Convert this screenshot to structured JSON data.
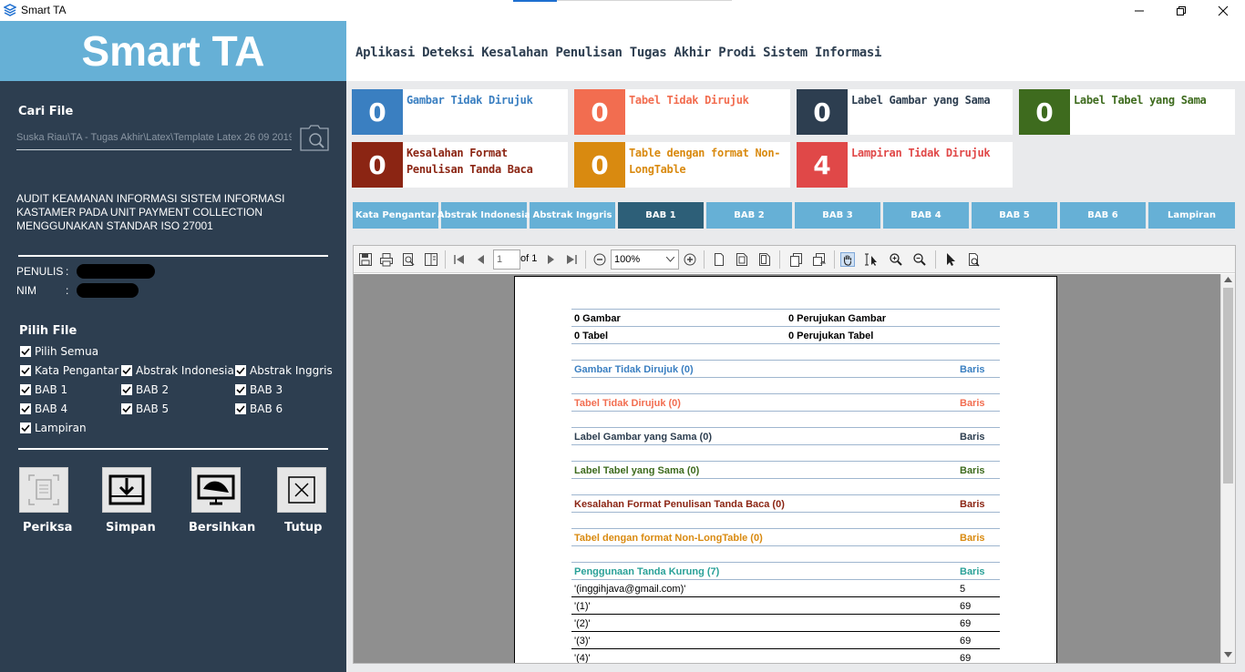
{
  "window": {
    "title": "Smart TA",
    "min_label": "─",
    "max_label": "❐",
    "close_label": "✕"
  },
  "sidebar": {
    "logo": "Smart TA",
    "cari_file": "Cari File",
    "path": "Suska Riau\\TA - Tugas Akhir\\Latex\\Template Latex 26 09 2019",
    "doc_title": "AUDIT KEAMANAN INFORMASI SISTEM INFORMASI KASTAMER PADA UNIT PAYMENT COLLECTION MENGGUNAKAN STANDAR ISO 27001",
    "penulis_label": "PENULIS",
    "nim_label": "NIM",
    "colon": ":",
    "pilih_file": "Pilih File",
    "checkboxes": [
      "Pilih Semua",
      "Kata Pengantar",
      "Abstrak Indonesia",
      "Abstrak Inggris",
      "BAB 1",
      "BAB 2",
      "BAB 3",
      "BAB 4",
      "BAB 5",
      "BAB 6",
      "Lampiran"
    ],
    "actions": [
      "Periksa",
      "Simpan",
      "Bersihkan",
      "Tutup"
    ]
  },
  "header": {
    "title": "Aplikasi Deteksi Kesalahan Penulisan Tugas Akhir Prodi Sistem Informasi"
  },
  "cards": [
    {
      "value": "0",
      "label": "Gambar Tidak Dirujuk",
      "color": "#3a7fc1"
    },
    {
      "value": "0",
      "label": "Tabel Tidak Dirujuk",
      "color": "#f26d50"
    },
    {
      "value": "0",
      "label": "Label Gambar yang Sama",
      "color": "#2d3e50"
    },
    {
      "value": "0",
      "label": "Label Tabel yang Sama",
      "color": "#3e6b1e"
    },
    {
      "value": "0",
      "label": "Kesalahan Format Penulisan Tanda Baca",
      "color": "#8b2513"
    },
    {
      "value": "0",
      "label": "Table dengan format Non-LongTable",
      "color": "#d98a10"
    },
    {
      "value": "4",
      "label": "Lampiran Tidak Dirujuk",
      "color": "#e04848"
    }
  ],
  "tabs": [
    "Kata Pengantar",
    "Abstrak Indonesia",
    "Abstrak Inggris",
    "BAB 1",
    "BAB 2",
    "BAB 3",
    "BAB 4",
    "BAB 5",
    "BAB 6",
    "Lampiran"
  ],
  "viewer": {
    "page": "1",
    "of": "of 1",
    "zoom": "100%"
  },
  "report": {
    "summary": [
      {
        "left": "0 Gambar",
        "right": "0 Perujukan Gambar"
      },
      {
        "left": "0 Tabel",
        "right": "0 Perujukan Tabel"
      }
    ],
    "baris": "Baris",
    "sections": [
      {
        "title": "Gambar Tidak Dirujuk (0)",
        "color": "#3a7fc1"
      },
      {
        "title": "Tabel Tidak Dirujuk (0)",
        "color": "#f26d50"
      },
      {
        "title": "Label Gambar yang Sama (0)",
        "color": "#2d3e50"
      },
      {
        "title": "Label Tabel yang Sama (0)",
        "color": "#3e6b1e"
      },
      {
        "title": "Kesalahan Format Penulisan Tanda Baca (0)",
        "color": "#8b2513"
      },
      {
        "title": "Tabel dengan format Non-LongTable (0)",
        "color": "#d98a10"
      },
      {
        "title": "Penggunaan Tanda Kurung (7)",
        "color": "#2aa198"
      }
    ],
    "kurung_rows": [
      {
        "text": "'(inggihjava@gmail.com)'",
        "line": "5"
      },
      {
        "text": "'(1)'",
        "line": "69"
      },
      {
        "text": "'(2)'",
        "line": "69"
      },
      {
        "text": "'(3)'",
        "line": "69"
      },
      {
        "text": "'(4)'",
        "line": "69"
      }
    ]
  }
}
